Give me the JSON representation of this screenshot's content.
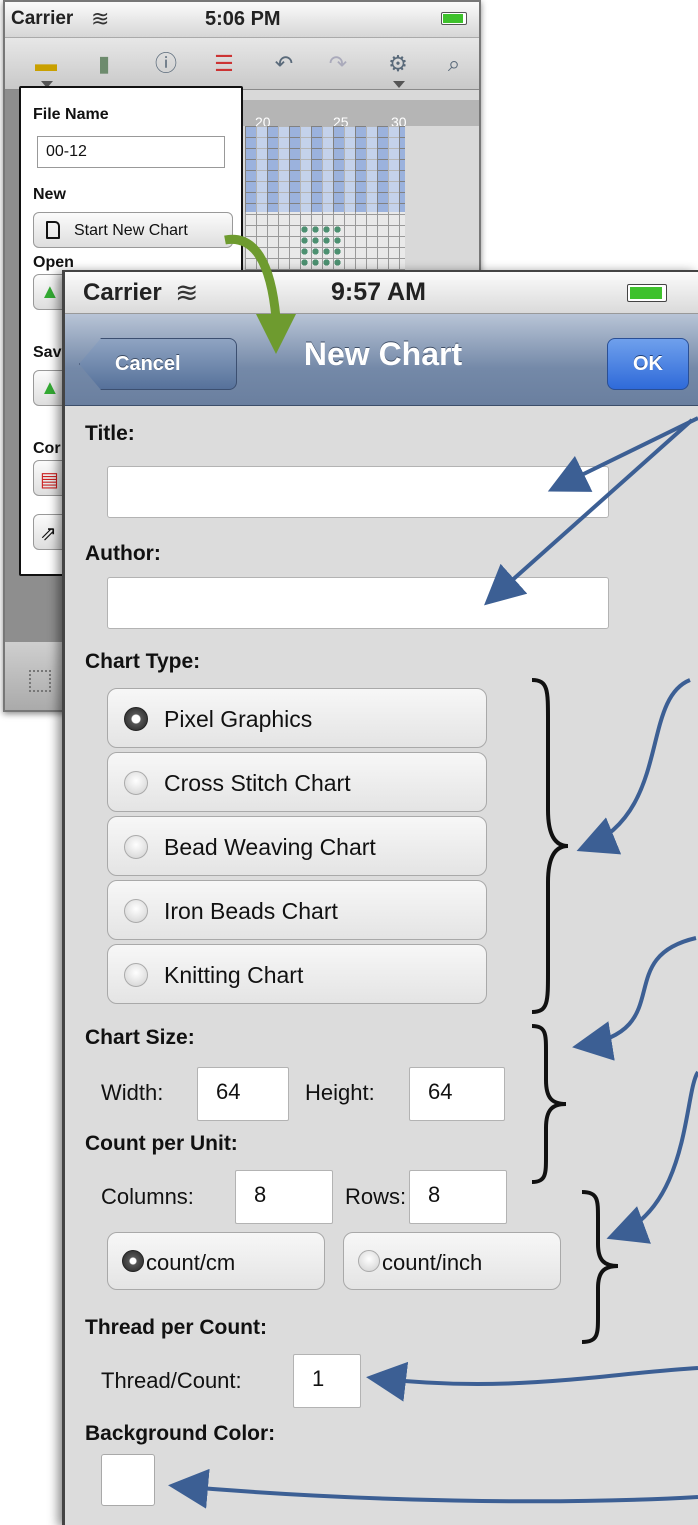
{
  "back_screen": {
    "status": {
      "carrier": "Carrier",
      "time": "5:06 PM"
    },
    "toolbar_icons": [
      "folder-icon",
      "save-icon",
      "info-icon",
      "list-icon",
      "undo-icon",
      "redo-icon",
      "settings-icon",
      "zoom-icon"
    ],
    "ruler": [
      "20",
      "25",
      "30"
    ],
    "popover": {
      "file_name_label": "File Name",
      "file_name_value": "00-12",
      "new_label": "New",
      "start_new_chart": "Start New Chart",
      "open_label": "Open",
      "save_label": "Sav",
      "convert_label": "Cor"
    }
  },
  "new_chart_screen": {
    "status": {
      "carrier": "Carrier",
      "time": "9:57 AM"
    },
    "nav": {
      "title": "New Chart",
      "cancel": "Cancel",
      "ok": "OK"
    },
    "title_label": "Title:",
    "title_value": "",
    "author_label": "Author:",
    "author_value": "",
    "chart_type_label": "Chart Type:",
    "chart_types": [
      {
        "label": "Pixel Graphics",
        "selected": true
      },
      {
        "label": "Cross Stitch Chart",
        "selected": false
      },
      {
        "label": "Bead Weaving Chart",
        "selected": false
      },
      {
        "label": "Iron Beads Chart",
        "selected": false
      },
      {
        "label": "Knitting Chart",
        "selected": false
      }
    ],
    "chart_size_label": "Chart Size:",
    "width_label": "Width:",
    "width_value": "64",
    "height_label": "Height:",
    "height_value": "64",
    "count_label": "Count per Unit:",
    "columns_label": "Columns:",
    "columns_value": "8",
    "rows_label": "Rows:",
    "rows_value": "8",
    "unit_options": [
      {
        "label": "count/cm",
        "selected": true
      },
      {
        "label": "count/inch",
        "selected": false
      }
    ],
    "thread_label": "Thread per Count:",
    "thread_count_label": "Thread/Count:",
    "thread_count_value": "1",
    "bg_color_label": "Background Color:",
    "bg_color_value": "#ffffff"
  },
  "colors": {
    "nav_blue": "#6a7f9f",
    "ok_blue": "#2f6ad9",
    "annotation_blue": "#3c5f94",
    "arrow_green": "#6e9b2f",
    "pixel_blue": "#8ea9dc",
    "pixel_green": "#4c9070"
  }
}
